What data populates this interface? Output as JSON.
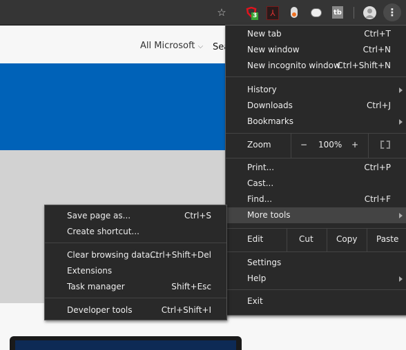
{
  "toolbar": {
    "icons": [
      "star-icon",
      "shield-extension-icon",
      "pdf-extension-icon",
      "toggle-extension-icon",
      "chat-extension-icon",
      "tb-extension-icon",
      "profile-avatar-icon",
      "more-menu-icon"
    ],
    "badge": "3",
    "tb_label": "tb"
  },
  "page": {
    "nav_all_microsoft": "All Microsoft",
    "nav_search": "Sea",
    "colors": {
      "hero": "#0062b8",
      "band": "#d2d2d2"
    }
  },
  "menu": {
    "new_tab": {
      "label": "New tab",
      "shortcut": "Ctrl+T"
    },
    "new_window": {
      "label": "New window",
      "shortcut": "Ctrl+N"
    },
    "new_incognito": {
      "label": "New incognito window",
      "shortcut": "Ctrl+Shift+N"
    },
    "history": {
      "label": "History"
    },
    "downloads": {
      "label": "Downloads",
      "shortcut": "Ctrl+J"
    },
    "bookmarks": {
      "label": "Bookmarks"
    },
    "zoom": {
      "label": "Zoom",
      "minus": "−",
      "value": "100%",
      "plus": "+"
    },
    "print": {
      "label": "Print...",
      "shortcut": "Ctrl+P"
    },
    "cast": {
      "label": "Cast..."
    },
    "find": {
      "label": "Find...",
      "shortcut": "Ctrl+F"
    },
    "more_tools": {
      "label": "More tools"
    },
    "edit": {
      "label": "Edit",
      "cut": "Cut",
      "copy": "Copy",
      "paste": "Paste"
    },
    "settings": {
      "label": "Settings"
    },
    "help": {
      "label": "Help"
    },
    "exit": {
      "label": "Exit"
    }
  },
  "submenu": {
    "save_page": {
      "label": "Save page as...",
      "shortcut": "Ctrl+S"
    },
    "create_shortcut": {
      "label": "Create shortcut..."
    },
    "clear_data": {
      "label": "Clear browsing data...",
      "shortcut": "Ctrl+Shift+Del"
    },
    "extensions": {
      "label": "Extensions"
    },
    "task_manager": {
      "label": "Task manager",
      "shortcut": "Shift+Esc"
    },
    "dev_tools": {
      "label": "Developer tools",
      "shortcut": "Ctrl+Shift+I"
    }
  }
}
